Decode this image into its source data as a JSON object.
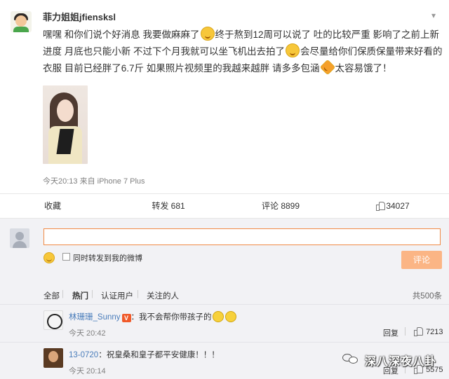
{
  "post": {
    "username": "菲力姐姐jfiensksl",
    "text_parts": [
      "嘿嘿 和你们说个好消息 我要做麻麻了",
      "终于熬到12周可以说了 吐的比较严重 影响了之前上新进度 月底也只能小新 不过下个月我就可以坐飞机出去拍了",
      "会尽量给你们保质保量带来好看的衣服 目前已经胖了6.7斤 如果照片视频里的我越来越胖 请多多包涵",
      "太容易饿了！"
    ],
    "meta": "今天20:13 来自 iPhone 7 Plus",
    "more_icon": "chevron-down-icon"
  },
  "actions": {
    "collect": "收藏",
    "forward": "转发 681",
    "comment": "评论 8899",
    "like": "34027"
  },
  "comment_box": {
    "placeholder": "",
    "sync_label": "同时转发到我的微博",
    "submit_label": "评论"
  },
  "filters": {
    "all": "全部",
    "hot": "热门",
    "auth": "认证用户",
    "follow": "关注的人",
    "total": "共500条"
  },
  "comments": [
    {
      "name": "林珊珊_Sunny",
      "text": "：我不会帮你带孩子的",
      "time": "今天 20:42",
      "reply": "回复",
      "likes": "7213"
    },
    {
      "name": "13-0720",
      "text": "：祝皇桑和皇子都平安健康！！！",
      "time": "今天 20:14",
      "reply": "回复",
      "likes": "5575"
    }
  ],
  "watermark": {
    "text": "深八深夜八卦"
  },
  "colors": {
    "accent": "#f08a46",
    "submit_bg": "#fbb585",
    "link_blue": "#4a7dbb",
    "panel_bg": "#f2f2f5"
  }
}
